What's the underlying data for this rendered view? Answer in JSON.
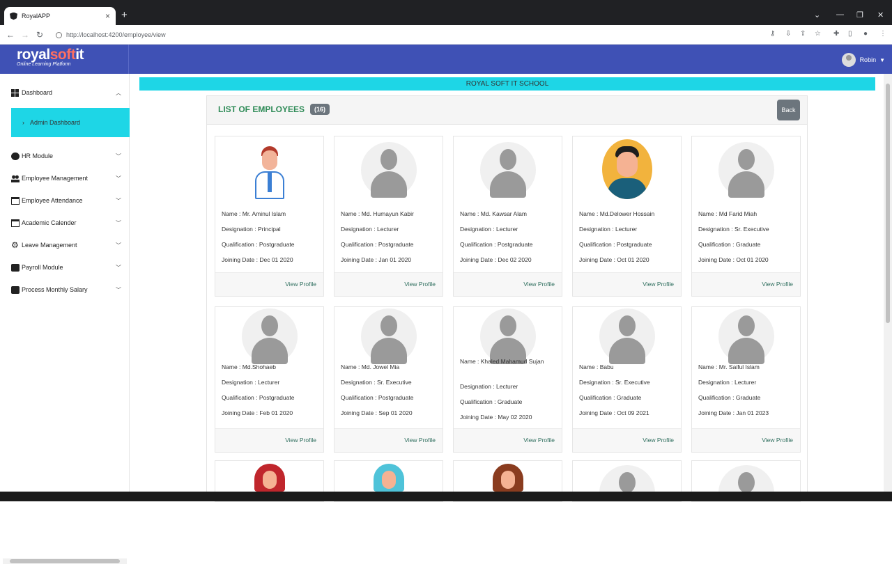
{
  "browser": {
    "tab_title": "RoyalAPP",
    "url": "http://localhost:4200/employee/view"
  },
  "header": {
    "logo_main": "royal",
    "logo_soft": "soft",
    "logo_it": "it",
    "tagline": "Online Learning Platform",
    "user_name": "Robin"
  },
  "sidebar": {
    "items": [
      {
        "label": "Dashboard",
        "icon": "grid-icon"
      },
      {
        "label": "HR Module",
        "icon": "gear-user-icon"
      },
      {
        "label": "Employee Management",
        "icon": "users-icon"
      },
      {
        "label": "Employee Attendance",
        "icon": "calendar-check-icon"
      },
      {
        "label": "Academic Calender",
        "icon": "calendar-icon"
      },
      {
        "label": "Leave Management",
        "icon": "gear-icon"
      },
      {
        "label": "Payroll Module",
        "icon": "payroll-icon"
      },
      {
        "label": "Process Monthly Salary",
        "icon": "money-icon"
      }
    ],
    "sub_item": "Admin Dashboard"
  },
  "main": {
    "banner": "ROYAL SOFT IT SCHOOL",
    "list_title": "LIST OF EMPLOYEES",
    "count": "(16)",
    "back_label": "Back",
    "labels": {
      "name": "Name : ",
      "designation": "Designation : ",
      "qualification": "Qualification : ",
      "joining": "Joining Date : ",
      "view_profile": "View Profile"
    },
    "employees": [
      {
        "name": "Mr. Aminul Islam",
        "designation": "Principal",
        "qualification": "Postgraduate",
        "joining": "Dec 01 2020",
        "avatar": "man-suit"
      },
      {
        "name": "Md. Humayun Kabir",
        "designation": "Lecturer",
        "qualification": "Postgraduate",
        "joining": "Jan 01 2020",
        "avatar": "generic"
      },
      {
        "name": "Md. Kawsar Alam",
        "designation": "Lecturer",
        "qualification": "Postgraduate",
        "joining": "Dec 02 2020",
        "avatar": "generic"
      },
      {
        "name": "Md.Delower Hossain",
        "designation": "Lecturer",
        "qualification": "Postgraduate",
        "joining": "Oct 01 2020",
        "avatar": "man-round"
      },
      {
        "name": "Md Farid Miah",
        "designation": "Sr. Executive",
        "qualification": "Graduate",
        "joining": "Oct 01 2020",
        "avatar": "generic"
      },
      {
        "name": "Md.Shohaeb",
        "designation": "Lecturer",
        "qualification": "Postgraduate",
        "joining": "Feb 01 2020",
        "avatar": "generic"
      },
      {
        "name": "Md. Jowel Mia",
        "designation": "Sr. Executive",
        "qualification": "Postgraduate",
        "joining": "Sep 01 2020",
        "avatar": "generic"
      },
      {
        "name": "Khaled Mahamud Sujan",
        "designation": "Lecturer",
        "qualification": "Graduate",
        "joining": "May 02 2020",
        "avatar": "generic"
      },
      {
        "name": "Babu",
        "designation": "Sr. Executive",
        "qualification": "Graduate",
        "joining": "Oct 09 2021",
        "avatar": "generic"
      },
      {
        "name": "Mr. Saiful Islam",
        "designation": "Lecturer",
        "qualification": "Graduate",
        "joining": "Jan 01 2023",
        "avatar": "generic"
      }
    ]
  },
  "colors": {
    "header": "#3f51b5",
    "accent": "#1ed6e6",
    "title_green": "#2e8b57",
    "badge": "#6c757d"
  }
}
